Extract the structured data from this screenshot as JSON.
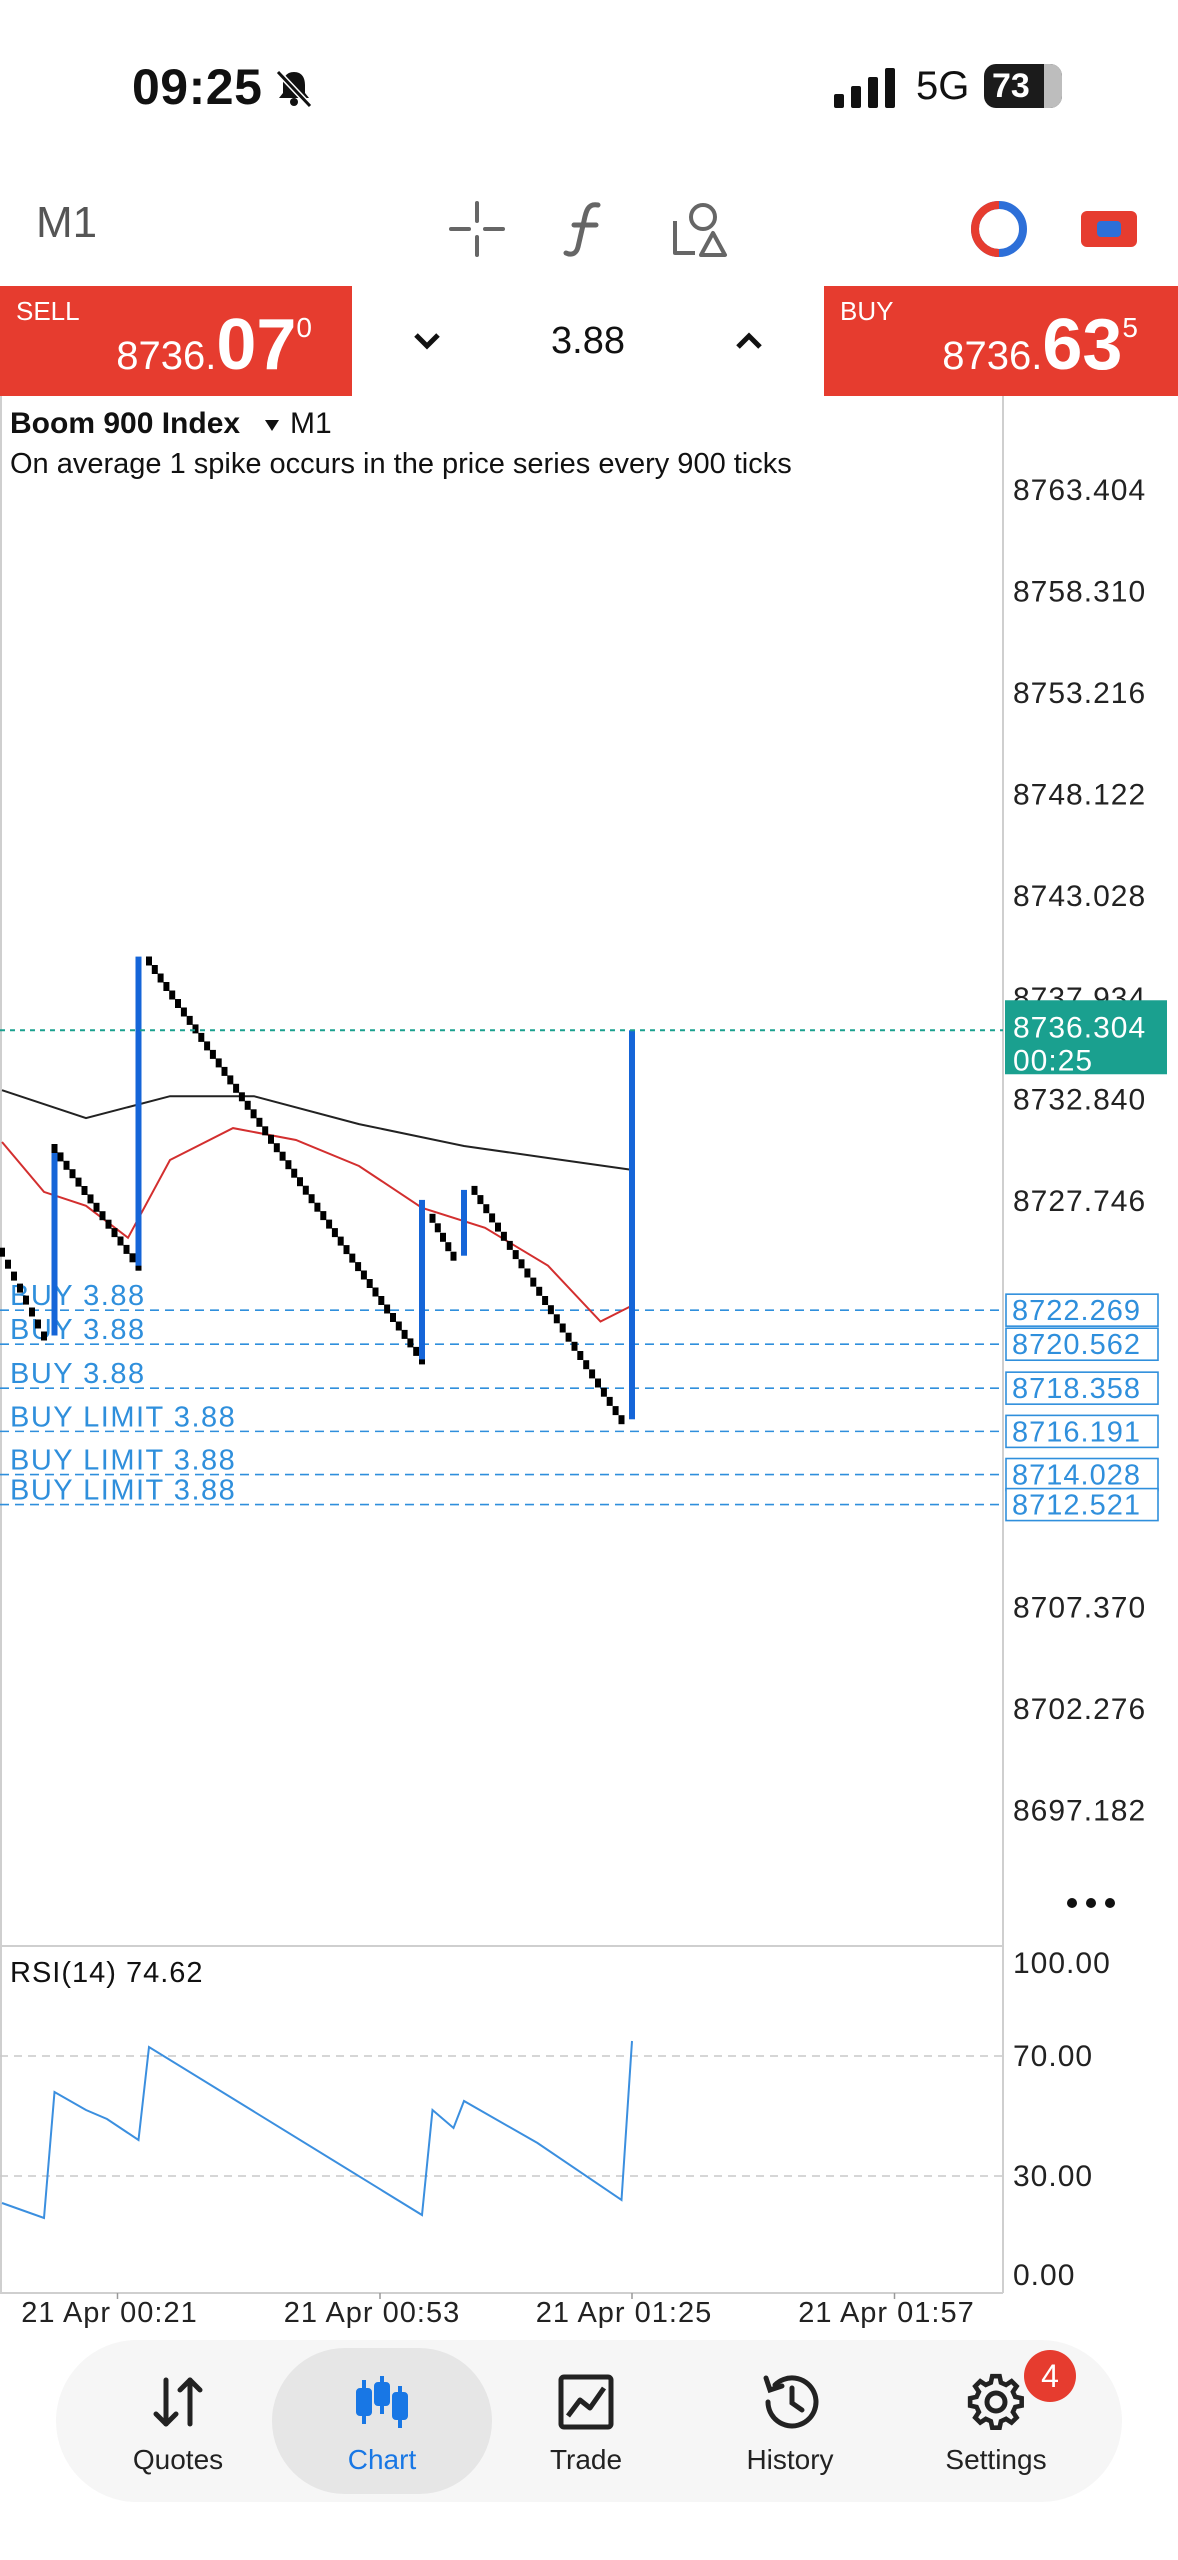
{
  "status_bar": {
    "time": "09:25",
    "network": "5G",
    "battery": "73"
  },
  "toolbar": {
    "timeframe": "M1",
    "icons": [
      "crosshair-icon",
      "indicator-f-icon",
      "objects-icon",
      "color-scheme-icon",
      "one-click-trading-icon"
    ]
  },
  "trade_panel": {
    "sell_label": "SELL",
    "sell_price_small": "8736.",
    "sell_price_big": "07",
    "sell_price_sup": "0",
    "volume": "3.88",
    "buy_label": "BUY",
    "buy_price_small": "8736.",
    "buy_price_big": "63",
    "buy_price_sup": "5"
  },
  "chart": {
    "symbol": "Boom 900 Index",
    "timeframe": "M1",
    "description": "On average 1 spike occurs in the price series every 900 ticks",
    "current_price": "8736.304",
    "countdown": "00:25",
    "more_icon": "more-dots-icon",
    "colors": {
      "bar": "#000000",
      "spike": "#1565d8",
      "ma_fast": "#d32f2f",
      "ma_slow": "#222222",
      "bid_line": "#1aa08f",
      "order": "#2f8fdc"
    }
  },
  "orders": [
    {
      "label": "BUY 3.88",
      "price": "8722.269"
    },
    {
      "label": "BUY 3.88",
      "price": "8720.562"
    },
    {
      "label": "BUY 3.88",
      "price": "8718.358"
    },
    {
      "label": "BUY LIMIT 3.88",
      "price": "8716.191"
    },
    {
      "label": "BUY LIMIT 3.88",
      "price": "8714.028"
    },
    {
      "label": "BUY LIMIT 3.88",
      "price": "8712.521"
    }
  ],
  "chart_data": {
    "type": "line",
    "price_axis": {
      "ticks": [
        "8763.404",
        "8758.310",
        "8753.216",
        "8748.122",
        "8743.028",
        "8737.934",
        "8732.840",
        "8727.746",
        "8707.370",
        "8702.276",
        "8697.182"
      ],
      "tick_values": [
        8763.404,
        8758.31,
        8753.216,
        8748.122,
        8743.028,
        8737.934,
        8732.84,
        8727.746,
        8707.37,
        8702.276,
        8697.182
      ],
      "range": [
        8694.9,
        8765.6
      ]
    },
    "time_axis": {
      "labels": [
        "21 Apr 00:21",
        "21 Apr 00:53",
        "21 Apr 01:25",
        "21 Apr 01:57"
      ],
      "bar_range": [
        0,
        60
      ],
      "label_bars": [
        11,
        36,
        60,
        85
      ]
    },
    "segments": [
      {
        "kind": "decline",
        "from": [
          0,
          8725.2
        ],
        "to": [
          4,
          8721.0
        ]
      },
      {
        "kind": "spike",
        "bar": 5,
        "low": 8721.0,
        "high": 8730.4
      },
      {
        "kind": "decline",
        "from": [
          5,
          8730.4
        ],
        "to": [
          13,
          8724.5
        ]
      },
      {
        "kind": "spike",
        "bar": 13,
        "low": 8724.5,
        "high": 8740.0
      },
      {
        "kind": "decline",
        "from": [
          14,
          8739.8
        ],
        "to": [
          40,
          8719.8
        ]
      },
      {
        "kind": "spike",
        "bar": 40,
        "low": 8719.8,
        "high": 8727.8
      },
      {
        "kind": "decline",
        "from": [
          41,
          8726.9
        ],
        "to": [
          43,
          8725.0
        ]
      },
      {
        "kind": "spike",
        "bar": 44,
        "low": 8725.0,
        "high": 8728.3
      },
      {
        "kind": "decline",
        "from": [
          45,
          8728.3
        ],
        "to": [
          59,
          8716.8
        ]
      },
      {
        "kind": "spike",
        "bar": 60,
        "low": 8716.8,
        "high": 8736.304
      }
    ],
    "ma_slow": [
      [
        0,
        8733.3
      ],
      [
        8,
        8731.9
      ],
      [
        16,
        8733.0
      ],
      [
        24,
        8733.0
      ],
      [
        34,
        8731.6
      ],
      [
        44,
        8730.5
      ],
      [
        52,
        8729.9
      ],
      [
        60,
        8729.3
      ]
    ],
    "ma_fast": [
      [
        0,
        8730.7
      ],
      [
        4,
        8728.2
      ],
      [
        8,
        8727.5
      ],
      [
        12,
        8725.9
      ],
      [
        16,
        8729.8
      ],
      [
        22,
        8731.4
      ],
      [
        28,
        8730.8
      ],
      [
        34,
        8729.5
      ],
      [
        40,
        8727.4
      ],
      [
        46,
        8726.4
      ],
      [
        52,
        8724.5
      ],
      [
        57,
        8721.7
      ],
      [
        60,
        8722.5
      ]
    ],
    "rsi": {
      "label": "RSI(14) 74.62",
      "value": 74.62,
      "levels": [
        "100.00",
        "70.00",
        "30.00",
        "0.00"
      ],
      "level_values": [
        100,
        70,
        30,
        0
      ],
      "series": [
        [
          0,
          21
        ],
        [
          4,
          16
        ],
        [
          5,
          58
        ],
        [
          8,
          52
        ],
        [
          10,
          49
        ],
        [
          13,
          42
        ],
        [
          14,
          73
        ],
        [
          40,
          17
        ],
        [
          41,
          52
        ],
        [
          43,
          46
        ],
        [
          44,
          55
        ],
        [
          51,
          41
        ],
        [
          59,
          22
        ],
        [
          60,
          75
        ]
      ]
    }
  },
  "bottom_nav": {
    "items": [
      {
        "label": "Quotes",
        "icon": "quotes-arrows-icon",
        "active": false
      },
      {
        "label": "Chart",
        "icon": "chart-candles-icon",
        "active": true
      },
      {
        "label": "Trade",
        "icon": "trade-chart-icon",
        "active": false
      },
      {
        "label": "History",
        "icon": "history-clock-icon",
        "active": false
      },
      {
        "label": "Settings",
        "icon": "settings-gear-icon",
        "active": false
      }
    ],
    "settings_badge": "4"
  }
}
